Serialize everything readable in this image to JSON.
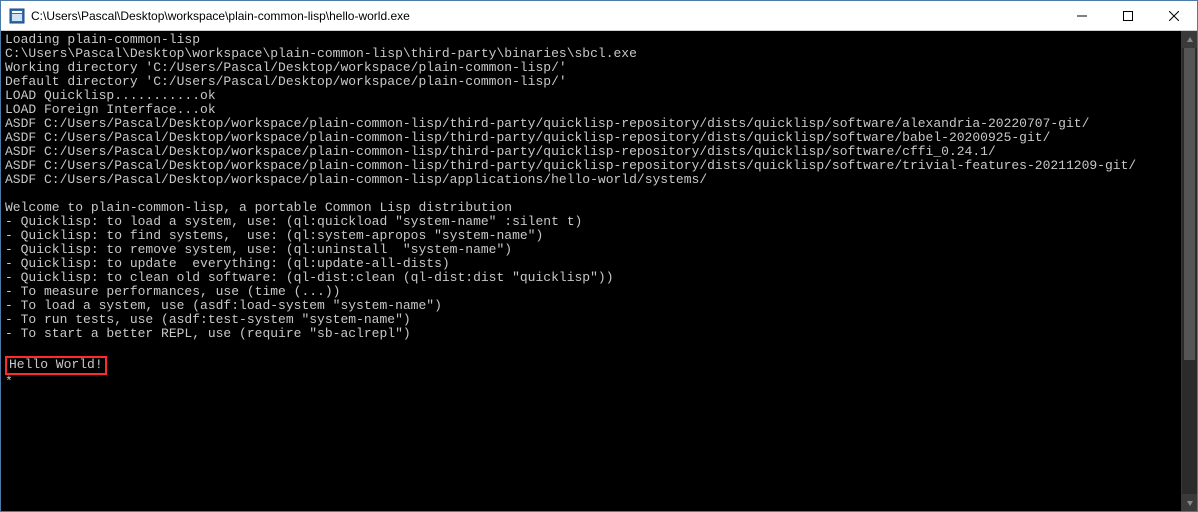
{
  "window": {
    "title": "C:\\Users\\Pascal\\Desktop\\workspace\\plain-common-lisp\\hello-world.exe"
  },
  "terminal": {
    "lines": [
      "Loading plain-common-lisp",
      "C:\\Users\\Pascal\\Desktop\\workspace\\plain-common-lisp\\third-party\\binaries\\sbcl.exe",
      "Working directory 'C:/Users/Pascal/Desktop/workspace/plain-common-lisp/'",
      "Default directory 'C:/Users/Pascal/Desktop/workspace/plain-common-lisp/'",
      "LOAD Quicklisp...........ok",
      "LOAD Foreign Interface...ok",
      "ASDF C:/Users/Pascal/Desktop/workspace/plain-common-lisp/third-party/quicklisp-repository/dists/quicklisp/software/alexandria-20220707-git/",
      "ASDF C:/Users/Pascal/Desktop/workspace/plain-common-lisp/third-party/quicklisp-repository/dists/quicklisp/software/babel-20200925-git/",
      "ASDF C:/Users/Pascal/Desktop/workspace/plain-common-lisp/third-party/quicklisp-repository/dists/quicklisp/software/cffi_0.24.1/",
      "ASDF C:/Users/Pascal/Desktop/workspace/plain-common-lisp/third-party/quicklisp-repository/dists/quicklisp/software/trivial-features-20211209-git/",
      "ASDF C:/Users/Pascal/Desktop/workspace/plain-common-lisp/applications/hello-world/systems/",
      "",
      "Welcome to plain-common-lisp, a portable Common Lisp distribution",
      "- Quicklisp: to load a system, use: (ql:quickload \"system-name\" :silent t)",
      "- Quicklisp: to find systems,  use: (ql:system-apropos \"system-name\")",
      "- Quicklisp: to remove system, use: (ql:uninstall  \"system-name\")",
      "- Quicklisp: to update  everything: (ql:update-all-dists)",
      "- Quicklisp: to clean old software: (ql-dist:clean (ql-dist:dist \"quicklisp\"))",
      "- To measure performances, use (time (...))",
      "- To load a system, use (asdf:load-system \"system-name\")",
      "- To run tests, use (asdf:test-system \"system-name\")",
      "- To start a better REPL, use (require \"sb-aclrepl\")",
      ""
    ],
    "highlighted": "Hello World!",
    "prompt": "*"
  }
}
